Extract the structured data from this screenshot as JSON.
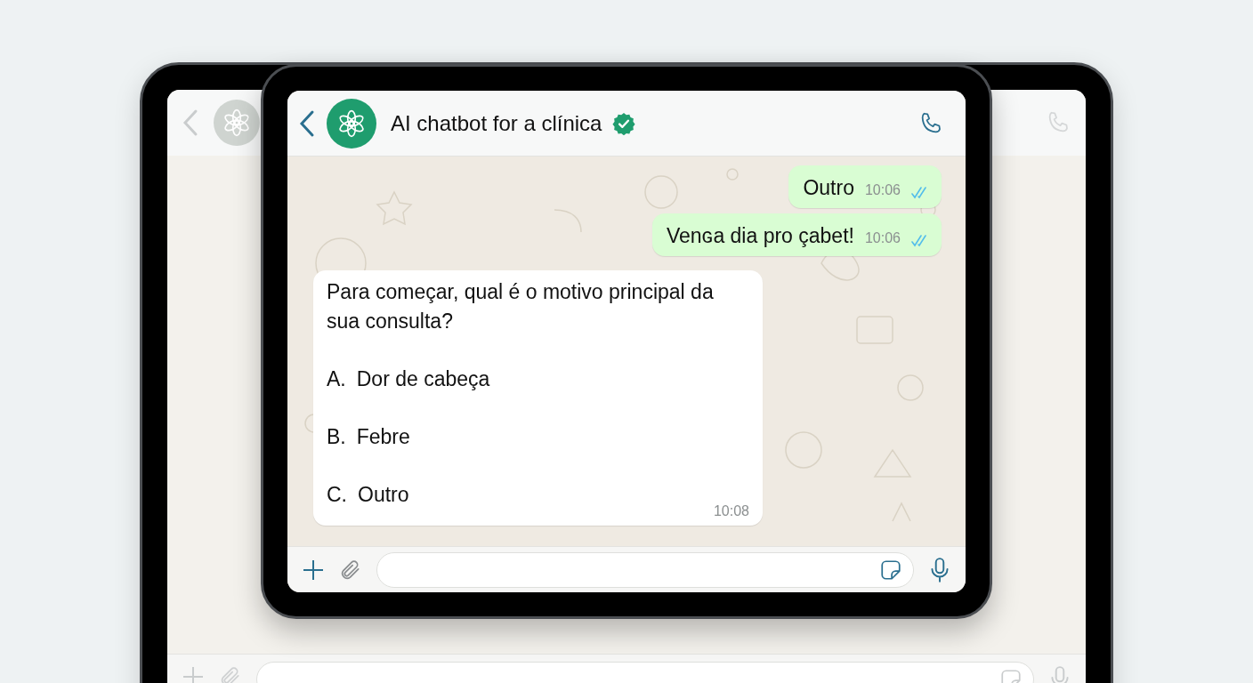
{
  "chat": {
    "title": "AI chatbot for a clínica",
    "verified": true,
    "messages": [
      {
        "kind": "outgoing",
        "text": "Outro",
        "time": "10:06",
        "read": true
      },
      {
        "kind": "outgoing",
        "text": "Venɢa dia pro çabet!",
        "time": "10:06",
        "read": true
      },
      {
        "kind": "incoming",
        "text": "Para começar, qual é o motivo principal da sua consulta?",
        "options": [
          {
            "letter": "A.",
            "text": "Dor de cabeça"
          },
          {
            "letter": "B.",
            "text": "Febre"
          },
          {
            "letter": "C.",
            "text": "Outro"
          }
        ],
        "time": "10:08"
      }
    ]
  }
}
